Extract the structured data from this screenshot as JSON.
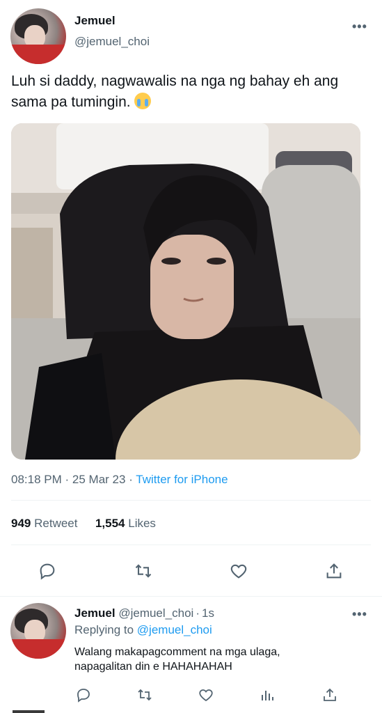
{
  "author": {
    "name": "Jemuel",
    "handle": "@jemuel_choi"
  },
  "tweet": {
    "text": "Luh si daddy, nagwawalis na nga ng bahay eh ang sama pa tumingin.",
    "emoji": "loudly-crying-face",
    "time": "08:18 PM",
    "date": "25 Mar 23",
    "source": "Twitter for iPhone",
    "separator": "·"
  },
  "stats": {
    "retweets": "949",
    "retweets_label": "Retweet",
    "likes": "1,554",
    "likes_label": "Likes"
  },
  "actions": [
    "reply-icon",
    "retweet-icon",
    "like-icon",
    "share-icon"
  ],
  "reply": {
    "name": "Jemuel",
    "handle": "@jemuel_choi",
    "time": "1s",
    "separator": "·",
    "replying_prefix": "Replying to",
    "replying_to": "@jemuel_choi",
    "text_line1": "Walang makapagcomment na mga ulaga,",
    "text_line2": "napagalitan din e HAHAHAHAH",
    "actions": [
      "reply-icon",
      "retweet-icon",
      "like-icon",
      "analytics-icon",
      "share-icon"
    ]
  },
  "more_label": "•••",
  "colors": {
    "accent": "#1d9bf0",
    "muted": "#536471",
    "text": "#0f1419",
    "divider": "#eff3f4"
  }
}
